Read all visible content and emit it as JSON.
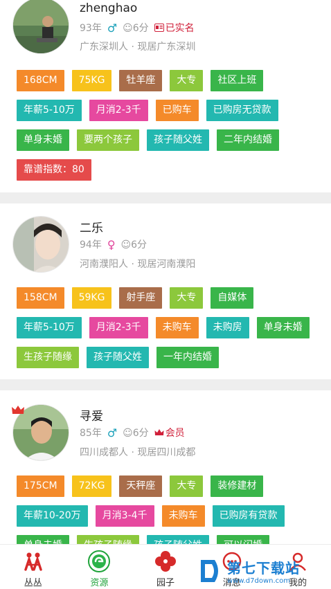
{
  "profiles": [
    {
      "name": "zhenghao",
      "age": "93年",
      "gender_symbol": "♂",
      "score": "☺6分",
      "badge": "已实名",
      "location": "广东深圳人 · 现居广东深圳",
      "tags": [
        {
          "text": "168CM",
          "color": "orange"
        },
        {
          "text": "75KG",
          "color": "yellow"
        },
        {
          "text": "牡羊座",
          "color": "brown"
        },
        {
          "text": "大专",
          "color": "lime"
        },
        {
          "text": "社区上班",
          "color": "green"
        },
        {
          "text": "年薪5-10万",
          "color": "teal"
        },
        {
          "text": "月消2-3千",
          "color": "pink"
        },
        {
          "text": "已购车",
          "color": "orange"
        },
        {
          "text": "已购房无贷款",
          "color": "teal"
        },
        {
          "text": "单身未婚",
          "color": "green"
        },
        {
          "text": "要两个孩子",
          "color": "lime"
        },
        {
          "text": "孩子随父姓",
          "color": "teal"
        },
        {
          "text": "二年内结婚",
          "color": "green"
        },
        {
          "text": "靠谱指数：80",
          "color": "red"
        }
      ]
    },
    {
      "name": "二乐",
      "age": "94年",
      "gender_symbol": "♀",
      "score": "☺6分",
      "badge": "",
      "location": "河南濮阳人 · 现居河南濮阳",
      "tags": [
        {
          "text": "158CM",
          "color": "orange"
        },
        {
          "text": "59KG",
          "color": "yellow"
        },
        {
          "text": "射手座",
          "color": "brown"
        },
        {
          "text": "大专",
          "color": "lime"
        },
        {
          "text": "自媒体",
          "color": "green"
        },
        {
          "text": "年薪5-10万",
          "color": "teal"
        },
        {
          "text": "月消2-3千",
          "color": "pink"
        },
        {
          "text": "未购车",
          "color": "orange"
        },
        {
          "text": "未购房",
          "color": "teal"
        },
        {
          "text": "单身未婚",
          "color": "green"
        },
        {
          "text": "生孩子随缘",
          "color": "lime"
        },
        {
          "text": "孩子随父姓",
          "color": "teal"
        },
        {
          "text": "一年内结婚",
          "color": "green"
        }
      ]
    },
    {
      "name": "寻爱",
      "age": "85年",
      "gender_symbol": "♂",
      "score": "☺6分",
      "badge": "会员",
      "location": "四川成都人 · 现居四川成都",
      "tags": [
        {
          "text": "175CM",
          "color": "orange"
        },
        {
          "text": "72KG",
          "color": "yellow"
        },
        {
          "text": "天秤座",
          "color": "brown"
        },
        {
          "text": "大专",
          "color": "lime"
        },
        {
          "text": "装修建材",
          "color": "green"
        },
        {
          "text": "年薪10-20万",
          "color": "teal"
        },
        {
          "text": "月消3-4千",
          "color": "pink"
        },
        {
          "text": "未购车",
          "color": "orange"
        },
        {
          "text": "已购房有贷款",
          "color": "teal"
        },
        {
          "text": "单身未婚",
          "color": "green"
        },
        {
          "text": "生孩子随缘",
          "color": "lime"
        },
        {
          "text": "孩子随父姓",
          "color": "teal"
        },
        {
          "text": "可以闪婚",
          "color": "green"
        }
      ]
    }
  ],
  "tabbar": [
    {
      "label": "丛丛",
      "icon": "couple-icon",
      "active": false
    },
    {
      "label": "资源",
      "icon": "resource-icon",
      "active": true
    },
    {
      "label": "园子",
      "icon": "clover-icon",
      "active": false
    },
    {
      "label": "消息",
      "icon": "message-icon",
      "active": false
    },
    {
      "label": "我的",
      "icon": "profile-icon",
      "active": false
    }
  ],
  "watermark": {
    "text": "第七下载站",
    "url": "www.d7down.com"
  },
  "colors": {
    "orange": "#f48a2a",
    "yellow": "#f7c21b",
    "brown": "#a96d4a",
    "lime": "#8cc83c",
    "green": "#39b54a",
    "teal": "#23b8b0",
    "pink": "#e6499f",
    "red": "#e54b4b",
    "active_tab": "#1fa33a",
    "male": "#1aa0b9",
    "female": "#e0449b",
    "badge": "#d0203a"
  }
}
